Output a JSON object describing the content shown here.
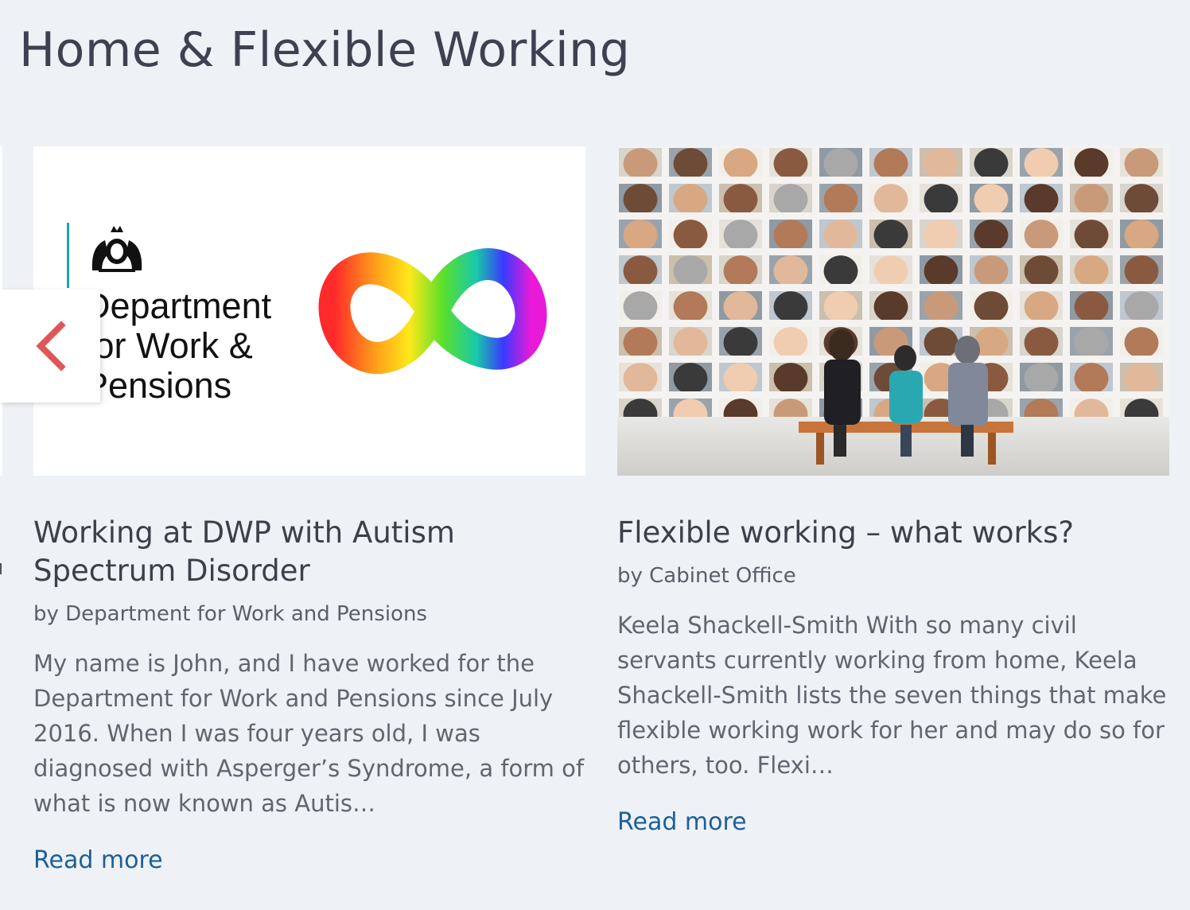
{
  "section": {
    "title": "Home & Flexible Working"
  },
  "carousel": {
    "prev_icon": "chevron-left-icon",
    "accent": "#e05656"
  },
  "cards": [
    {
      "image": {
        "logo_text": [
          "Department",
          "for Work &",
          "Pensions"
        ],
        "icon": "infinity-icon"
      },
      "title": "Working at DWP with Autism Spectrum Disorder",
      "author": "by Department for Work and Pensions",
      "excerpt": "My name is John, and I have worked for the Department for Work and Pensions since July 2016. When I was four years old, I was diagnosed with Asperger’s Syndrome, a form of what is now known as Autis…",
      "link": "Read more"
    },
    {
      "image": {
        "description_icon": "faces-wall-photo"
      },
      "title": "Flexible working – what works?",
      "author": "by Cabinet Office",
      "excerpt": "Keela Shackell-Smith With so many civil servants currently working from home, Keela Shackell-Smith lists the seven things that make flexible working work for her and may do so for others, too. Flexi…",
      "link": "Read more"
    }
  ],
  "colors": {
    "link": "#1d5f9a",
    "background": "#eef2f7",
    "dwp_teal": "#18a9a3"
  }
}
